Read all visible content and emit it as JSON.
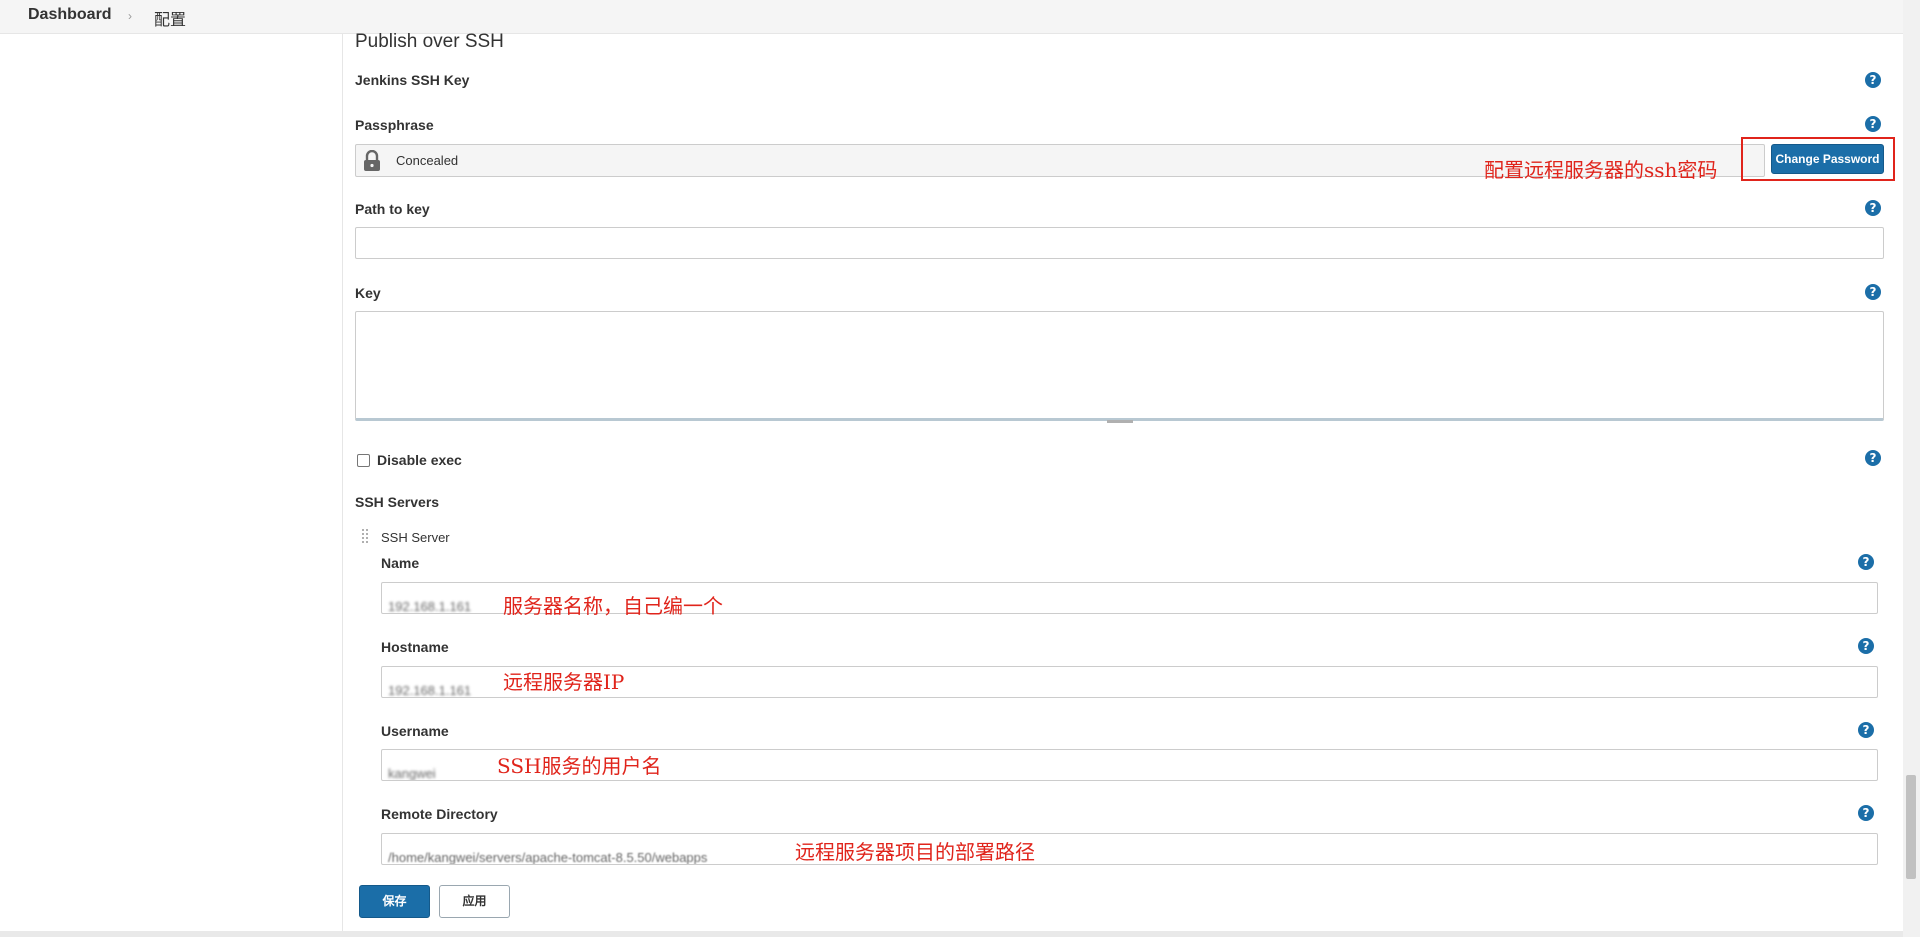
{
  "breadcrumb": {
    "home": "Dashboard",
    "separator": "›",
    "current": "配置"
  },
  "section": {
    "title": "Publish over SSH"
  },
  "fields": {
    "jenkins_ssh_key_label": "Jenkins SSH Key",
    "passphrase_label": "Passphrase",
    "passphrase_value": "Concealed",
    "change_password_button": "Change Password",
    "path_to_key_label": "Path to key",
    "path_to_key_value": "",
    "key_label": "Key",
    "key_value": "",
    "disable_exec_label": "Disable exec",
    "disable_exec_checked": false
  },
  "ssh_servers": {
    "section_label": "SSH Servers",
    "server_header": "SSH Server",
    "name_label": "Name",
    "name_value": "192.168.1.161",
    "hostname_label": "Hostname",
    "hostname_value": "192.168.1.161",
    "username_label": "Username",
    "username_value": "kangwei",
    "remote_directory_label": "Remote Directory",
    "remote_directory_value": "/home/kangwei/servers/apache-tomcat-8.5.50/webapps"
  },
  "annotations": {
    "change_password": "配置远程服务器的ssh密码",
    "name": "服务器名称，自己编一个",
    "hostname": "远程服务器IP",
    "username": "SSH服务的用户名",
    "remote_directory": "远程服务器项目的部署路径"
  },
  "buttons": {
    "save": "保存",
    "apply": "应用"
  },
  "help_icon_glyph": "?",
  "colors": {
    "primary": "#1b6ea8",
    "annotation": "#e0241b"
  }
}
